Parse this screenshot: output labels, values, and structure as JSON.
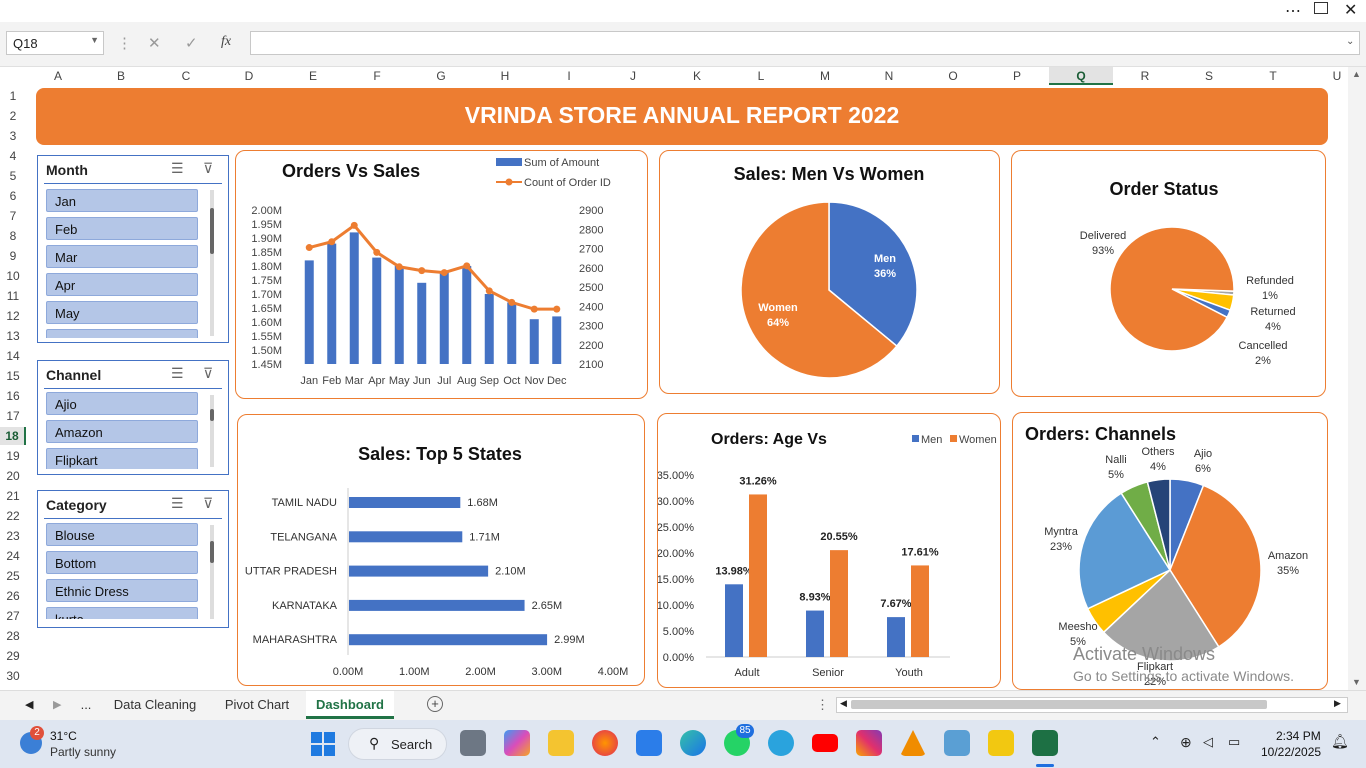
{
  "window": {
    "more_icon": "ellipsis-icon",
    "restore_icon": "restore-icon",
    "close_icon": "close-icon"
  },
  "formula_bar": {
    "name_box": "Q18",
    "fx": "fx",
    "formula": ""
  },
  "columns": [
    "A",
    "B",
    "C",
    "D",
    "E",
    "F",
    "G",
    "H",
    "I",
    "J",
    "K",
    "L",
    "M",
    "N",
    "O",
    "P",
    "Q",
    "R",
    "S",
    "T",
    "U"
  ],
  "selected_column": "Q",
  "rows": [
    "1",
    "2",
    "3",
    "4",
    "5",
    "6",
    "7",
    "8",
    "9",
    "10",
    "11",
    "12",
    "13",
    "14",
    "15",
    "16",
    "17",
    "18",
    "19",
    "20",
    "21",
    "22",
    "23",
    "24",
    "25",
    "26",
    "27",
    "28",
    "29",
    "30"
  ],
  "selected_row": "18",
  "banner": "VRINDA STORE ANNUAL REPORT 2022",
  "slicers": {
    "month": {
      "title": "Month",
      "items": [
        "Jan",
        "Feb",
        "Mar",
        "Apr",
        "May"
      ]
    },
    "channel": {
      "title": "Channel",
      "items": [
        "Ajio",
        "Amazon",
        "Flipkart"
      ]
    },
    "category": {
      "title": "Category",
      "items": [
        "Blouse",
        "Bottom",
        "Ethnic Dress",
        "kurta"
      ]
    }
  },
  "chart_data": [
    {
      "type": "bar",
      "title": "Orders Vs Sales",
      "categories": [
        "Jan",
        "Feb",
        "Mar",
        "Apr",
        "May",
        "Jun",
        "Jul",
        "Aug",
        "Sep",
        "Oct",
        "Nov",
        "Dec"
      ],
      "series": [
        {
          "name": "Sum of Amount",
          "axis": "left",
          "values": [
            1.82,
            1.88,
            1.92,
            1.83,
            1.8,
            1.74,
            1.78,
            1.8,
            1.7,
            1.67,
            1.61,
            1.62
          ],
          "unit": "M"
        },
        {
          "name": "Count of Order ID",
          "axis": "right",
          "type": "line",
          "values": [
            2705,
            2735,
            2820,
            2680,
            2605,
            2585,
            2575,
            2610,
            2480,
            2420,
            2385,
            2385
          ]
        }
      ],
      "y_left_ticks": [
        "2.00M",
        "1.95M",
        "1.90M",
        "1.85M",
        "1.80M",
        "1.75M",
        "1.70M",
        "1.65M",
        "1.60M",
        "1.55M",
        "1.50M",
        "1.45M"
      ],
      "y_left_range": [
        1.45,
        2.0
      ],
      "y_right_ticks": [
        "2900",
        "2800",
        "2700",
        "2600",
        "2500",
        "2400",
        "2300",
        "2200",
        "2100"
      ],
      "y_right_range": [
        2100,
        2900
      ],
      "legend": "top-right"
    },
    {
      "type": "pie",
      "title": "Sales: Men Vs Women",
      "slices": [
        {
          "label": "Men",
          "value": 36,
          "pct": "36%",
          "color": "#4472c4"
        },
        {
          "label": "Women",
          "value": 64,
          "pct": "64%",
          "color": "#ed7d31"
        }
      ]
    },
    {
      "type": "pie",
      "title": "Order Status",
      "slices": [
        {
          "label": "Delivered",
          "value": 93,
          "pct": "93%",
          "color": "#ed7d31"
        },
        {
          "label": "Refunded",
          "value": 1,
          "pct": "1%",
          "color": "#a5a5a5"
        },
        {
          "label": "Returned",
          "value": 4,
          "pct": "4%",
          "color": "#ffc000"
        },
        {
          "label": "Cancelled",
          "value": 2,
          "pct": "2%",
          "color": "#4472c4"
        }
      ]
    },
    {
      "type": "bar",
      "orientation": "horizontal",
      "title": "Sales: Top 5 States",
      "categories": [
        "TAMIL NADU",
        "TELANGANA",
        "UTTAR PRADESH",
        "KARNATAKA",
        "MAHARASHTRA"
      ],
      "values": [
        1.68,
        1.71,
        2.1,
        2.65,
        2.99
      ],
      "labels": [
        "1.68M",
        "1.71M",
        "2.10M",
        "2.65M",
        "2.99M"
      ],
      "x_ticks": [
        "0.00M",
        "1.00M",
        "2.00M",
        "3.00M",
        "4.00M"
      ],
      "xlim": [
        0,
        4
      ]
    },
    {
      "type": "bar",
      "title": "Orders: Age Vs",
      "categories": [
        "Adult",
        "Senior",
        "Youth"
      ],
      "series": [
        {
          "name": "Men",
          "values": [
            13.98,
            8.93,
            7.67
          ],
          "labels": [
            "13.98%",
            "8.93%",
            "7.67%"
          ],
          "color": "#4472c4"
        },
        {
          "name": "Women",
          "values": [
            31.26,
            20.55,
            17.61
          ],
          "labels": [
            "31.26%",
            "20.55%",
            "17.61%"
          ],
          "color": "#ed7d31"
        }
      ],
      "y_ticks": [
        "35.00%",
        "30.00%",
        "25.00%",
        "20.00%",
        "15.00%",
        "10.00%",
        "5.00%",
        "0.00%"
      ],
      "ylim": [
        0,
        35
      ],
      "legend": "top-right"
    },
    {
      "type": "pie",
      "title": "Orders: Channels",
      "slices": [
        {
          "label": "Ajio",
          "value": 6,
          "pct": "6%",
          "color": "#4472c4"
        },
        {
          "label": "Amazon",
          "value": 35,
          "pct": "35%",
          "color": "#ed7d31"
        },
        {
          "label": "Flipkart",
          "value": 22,
          "pct": "22%",
          "color": "#a5a5a5"
        },
        {
          "label": "Meesho",
          "value": 5,
          "pct": "5%",
          "color": "#ffc000"
        },
        {
          "label": "Myntra",
          "value": 23,
          "pct": "23%",
          "color": "#5b9bd5"
        },
        {
          "label": "Nalli",
          "value": 5,
          "pct": "5%",
          "color": "#70ad47"
        },
        {
          "label": "Others",
          "value": 4,
          "pct": "4%",
          "color": "#264478"
        }
      ]
    }
  ],
  "watermark": {
    "line1": "Activate Windows",
    "line2": "Go to Settings to activate Windows."
  },
  "sheet_tabs": {
    "ellipsis": "...",
    "tabs": [
      "Data Cleaning",
      "Pivot Chart",
      "Dashboard"
    ],
    "active": "Dashboard"
  },
  "taskbar": {
    "weather_temp": "31°C",
    "weather_desc": "Partly sunny",
    "weather_badge": "2",
    "search": "Search",
    "whatsapp_badge": "85",
    "time": "2:34 PM",
    "date": "10/22/2025"
  }
}
